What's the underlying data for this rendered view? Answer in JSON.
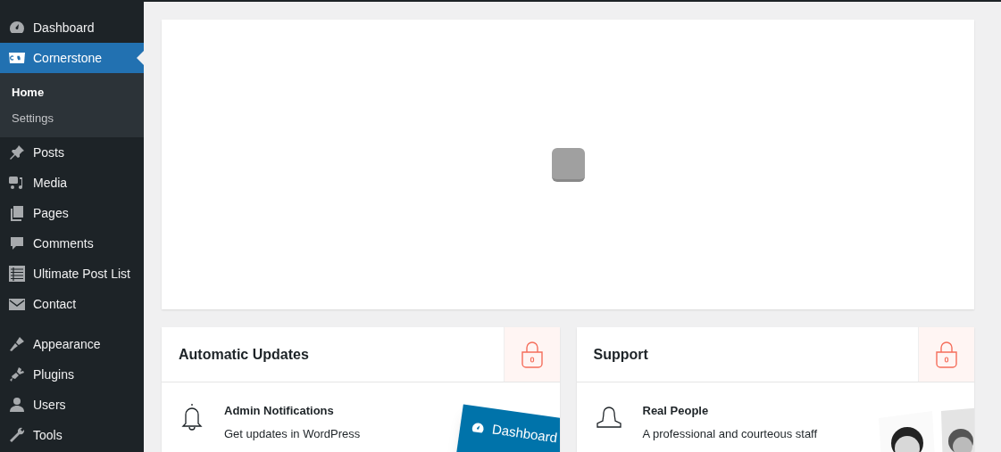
{
  "sidebar": {
    "groups": [
      [
        {
          "label": "Dashboard",
          "kind": "dashboard",
          "selected": false
        },
        {
          "label": "Cornerstone",
          "kind": "cs",
          "selected": true,
          "children": [
            {
              "label": "Home",
              "selected": true
            },
            {
              "label": "Settings",
              "selected": false
            }
          ]
        },
        {
          "label": "Posts",
          "kind": "pin",
          "selected": false
        },
        {
          "label": "Media",
          "kind": "media",
          "selected": false
        },
        {
          "label": "Pages",
          "kind": "pages",
          "selected": false
        },
        {
          "label": "Comments",
          "kind": "comment",
          "selected": false
        },
        {
          "label": "Ultimate Post List",
          "kind": "list",
          "selected": false
        },
        {
          "label": "Contact",
          "kind": "mail",
          "selected": false
        }
      ],
      [
        {
          "label": "Appearance",
          "kind": "brush",
          "selected": false
        },
        {
          "label": "Plugins",
          "kind": "plug",
          "selected": false
        },
        {
          "label": "Users",
          "kind": "user",
          "selected": false
        },
        {
          "label": "Tools",
          "kind": "wrench",
          "selected": false
        }
      ]
    ]
  },
  "main_panel": {
    "loading": true
  },
  "cards": [
    {
      "title": "Automatic Updates",
      "locked": true,
      "feature": {
        "kind": "bell",
        "title": "Admin Notifications",
        "text": "Get updates in WordPress"
      },
      "art": {
        "kind": "menu",
        "label": "Dashboard"
      }
    },
    {
      "title": "Support",
      "locked": true,
      "feature": {
        "kind": "person",
        "title": "Real People",
        "text": "A professional and courteous staff"
      }
    }
  ]
}
